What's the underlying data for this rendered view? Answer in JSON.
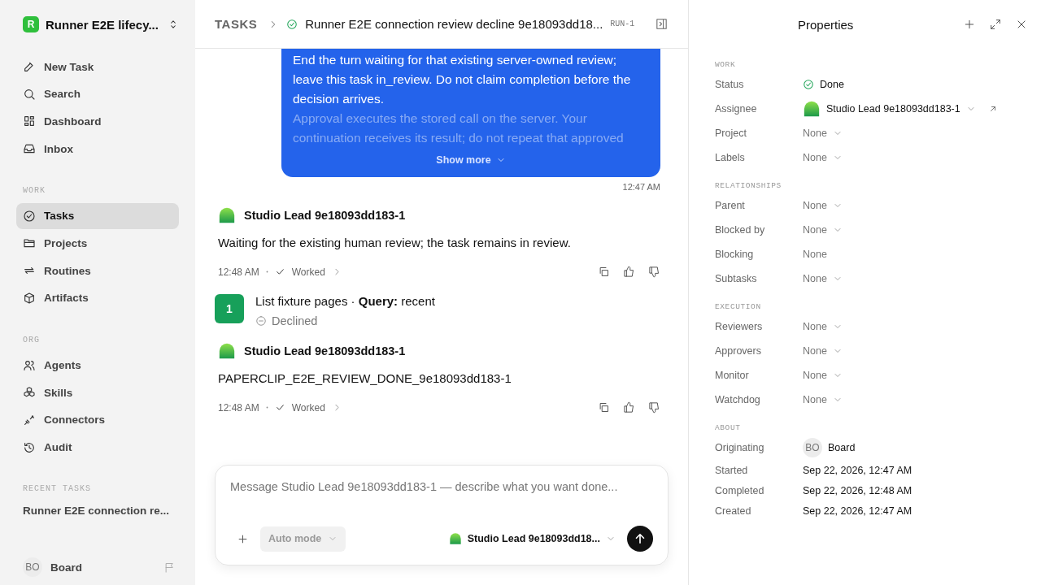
{
  "workspace": {
    "initial": "R",
    "name": "Runner E2E lifecy..."
  },
  "sidebar": {
    "sections": [
      {
        "items": [
          {
            "label": "New Task",
            "selected": false
          },
          {
            "label": "Search",
            "selected": false
          },
          {
            "label": "Dashboard",
            "selected": false
          },
          {
            "label": "Inbox",
            "selected": false
          }
        ]
      },
      {
        "title": "WORK",
        "items": [
          {
            "label": "Tasks",
            "selected": true
          },
          {
            "label": "Projects",
            "selected": false
          },
          {
            "label": "Routines",
            "selected": false
          },
          {
            "label": "Artifacts",
            "selected": false
          }
        ]
      },
      {
        "title": "ORG",
        "items": [
          {
            "label": "Agents",
            "selected": false
          },
          {
            "label": "Skills",
            "selected": false
          },
          {
            "label": "Connectors",
            "selected": false
          },
          {
            "label": "Audit",
            "selected": false
          }
        ]
      }
    ],
    "recent": {
      "title": "RECENT TASKS",
      "items": [
        "Runner E2E connection re..."
      ]
    },
    "user": {
      "initials": "BO",
      "name": "Board"
    }
  },
  "header": {
    "breadcrumb": "TASKS",
    "done": true,
    "title": "Runner E2E connection review decline 9e18093dd18...",
    "id": "RUN-1"
  },
  "thread": [
    {
      "kind": "user_message",
      "text": "End the turn waiting for that existing server-owned review; leave this task in_review. Do not claim completion before the decision arrives.",
      "faded_text": "Approval executes the stored call on the server. Your continuation receives its result; do not repeat that approved",
      "show_more": "Show more",
      "time": "12:47 AM"
    },
    {
      "kind": "agent_message",
      "author": "Studio Lead 9e18093dd183-1",
      "text": "Waiting for the existing human review; the task remains in review.",
      "time": "12:48 AM",
      "status": "Worked"
    },
    {
      "kind": "tool_call",
      "number": "1",
      "title": "List fixture pages · **Query:** recent",
      "status": "Declined"
    },
    {
      "kind": "agent_message",
      "author": "Studio Lead 9e18093dd183-1",
      "text": "PAPERCLIP_E2E_REVIEW_DONE_9e18093dd183-1",
      "time": "12:48 AM",
      "status": "Worked"
    }
  ],
  "composer": {
    "placeholder": "Message Studio Lead 9e18093dd183-1 — describe what you want done...",
    "mode": "Auto mode",
    "agent": "Studio Lead 9e18093dd18..."
  },
  "properties": {
    "title": "Properties",
    "sections": [
      {
        "title": "WORK",
        "rows": [
          {
            "label": "Status",
            "kind": "status",
            "value": "Done"
          },
          {
            "label": "Assignee",
            "kind": "agent",
            "value": "Studio Lead 9e18093dd183-1"
          },
          {
            "label": "Project",
            "kind": "select",
            "value": "None"
          },
          {
            "label": "Labels",
            "kind": "select",
            "value": "None"
          }
        ]
      },
      {
        "title": "RELATIONSHIPS",
        "rows": [
          {
            "label": "Parent",
            "kind": "select",
            "value": "None"
          },
          {
            "label": "Blocked by",
            "kind": "select",
            "value": "None"
          },
          {
            "label": "Blocking",
            "kind": "plain",
            "value": "None"
          },
          {
            "label": "Subtasks",
            "kind": "select",
            "value": "None"
          }
        ]
      },
      {
        "title": "EXECUTION",
        "rows": [
          {
            "label": "Reviewers",
            "kind": "select",
            "value": "None"
          },
          {
            "label": "Approvers",
            "kind": "select",
            "value": "None"
          },
          {
            "label": "Monitor",
            "kind": "select",
            "value": "None"
          },
          {
            "label": "Watchdog",
            "kind": "select",
            "value": "None"
          }
        ]
      },
      {
        "title": "ABOUT",
        "rows": [
          {
            "label": "Originating",
            "kind": "user",
            "initials": "BO",
            "value": "Board"
          },
          {
            "label": "Started",
            "kind": "date",
            "value": "Sep 22, 2026, 12:47 AM"
          },
          {
            "label": "Completed",
            "kind": "date",
            "value": "Sep 22, 2026, 12:48 AM"
          },
          {
            "label": "Created",
            "kind": "date",
            "value": "Sep 22, 2026, 12:47 AM"
          }
        ]
      }
    ]
  }
}
